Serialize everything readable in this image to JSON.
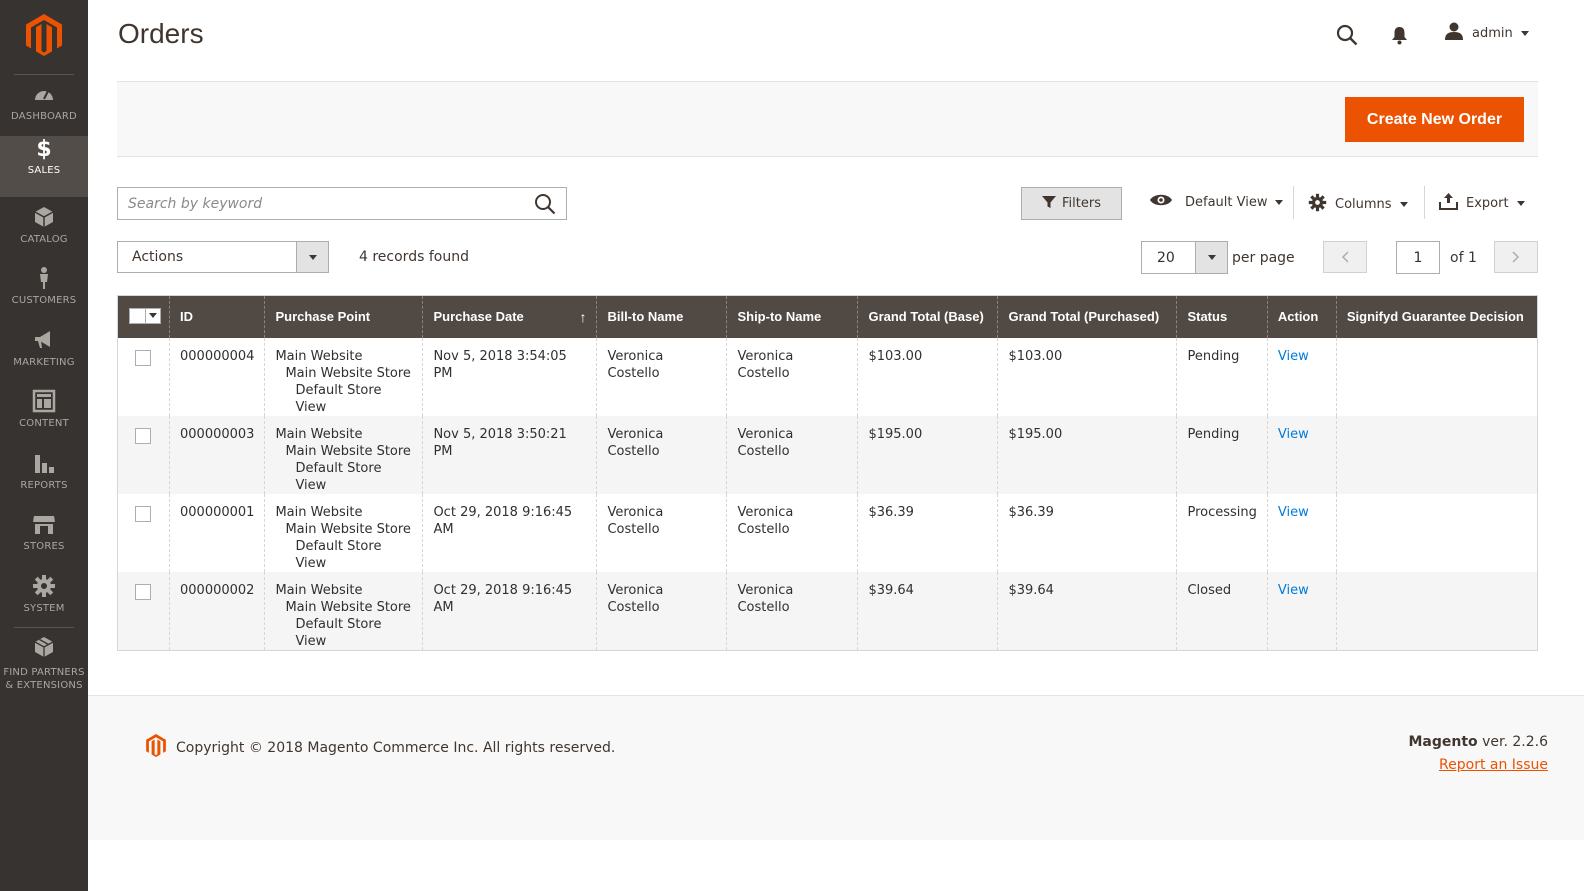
{
  "sidebar": {
    "items": [
      {
        "label": "DASHBOARD",
        "icon": "dashboard-icon"
      },
      {
        "label": "SALES",
        "icon": "dollar-icon"
      },
      {
        "label": "CATALOG",
        "icon": "box-icon"
      },
      {
        "label": "CUSTOMERS",
        "icon": "person-icon"
      },
      {
        "label": "MARKETING",
        "icon": "megaphone-icon"
      },
      {
        "label": "CONTENT",
        "icon": "layout-icon"
      },
      {
        "label": "REPORTS",
        "icon": "bar-chart-icon"
      },
      {
        "label": "STORES",
        "icon": "storefront-icon"
      },
      {
        "label": "SYSTEM",
        "icon": "gear-icon"
      },
      {
        "label_line1": "FIND PARTNERS",
        "label_line2": "& EXTENSIONS",
        "icon": "cubes-icon"
      }
    ]
  },
  "header": {
    "title": "Orders",
    "user": "admin"
  },
  "action_bar": {
    "create_label": "Create New Order"
  },
  "toolbar": {
    "search_placeholder": "Search by keyword",
    "filters_label": "Filters",
    "view_label": "Default View",
    "columns_label": "Columns",
    "export_label": "Export",
    "actions_label": "Actions",
    "records_found": "4 records found",
    "per_page_value": "20",
    "per_page_label": "per page",
    "page_value": "1",
    "of_label": "of 1"
  },
  "grid": {
    "columns": [
      "ID",
      "Purchase Point",
      "Purchase Date",
      "Bill-to Name",
      "Ship-to Name",
      "Grand Total (Base)",
      "Grand Total (Purchased)",
      "Status",
      "Action",
      "Signifyd Guarantee Decision"
    ],
    "sort_indicator": "↑",
    "rows": [
      {
        "id": "000000004",
        "pp1": "Main Website",
        "pp2": "Main Website Store",
        "pp3": "Default Store View",
        "date": "Nov 5, 2018 3:54:05 PM",
        "bill": "Veronica Costello",
        "ship": "Veronica Costello",
        "base": "$103.00",
        "purchased": "$103.00",
        "status": "Pending",
        "action": "View",
        "signifyd": ""
      },
      {
        "id": "000000003",
        "pp1": "Main Website",
        "pp2": "Main Website Store",
        "pp3": "Default Store View",
        "date": "Nov 5, 2018 3:50:21 PM",
        "bill": "Veronica Costello",
        "ship": "Veronica Costello",
        "base": "$195.00",
        "purchased": "$195.00",
        "status": "Pending",
        "action": "View",
        "signifyd": ""
      },
      {
        "id": "000000001",
        "pp1": "Main Website",
        "pp2": "Main Website Store",
        "pp3": "Default Store View",
        "date": "Oct 29, 2018 9:16:45 AM",
        "bill": "Veronica Costello",
        "ship": "Veronica Costello",
        "base": "$36.39",
        "purchased": "$36.39",
        "status": "Processing",
        "action": "View",
        "signifyd": ""
      },
      {
        "id": "000000002",
        "pp1": "Main Website",
        "pp2": "Main Website Store",
        "pp3": "Default Store View",
        "date": "Oct 29, 2018 9:16:45 AM",
        "bill": "Veronica Costello",
        "ship": "Veronica Costello",
        "base": "$39.64",
        "purchased": "$39.64",
        "status": "Closed",
        "action": "View",
        "signifyd": ""
      }
    ]
  },
  "footer": {
    "copyright": "Copyright © 2018 Magento Commerce Inc. All rights reserved.",
    "brand": "Magento",
    "version": " ver. 2.2.6",
    "report_label": "Report an Issue"
  },
  "colors": {
    "accent": "#eb5202",
    "sidebar_bg": "#373330",
    "header_bg": "#514943",
    "link": "#007bdb"
  }
}
